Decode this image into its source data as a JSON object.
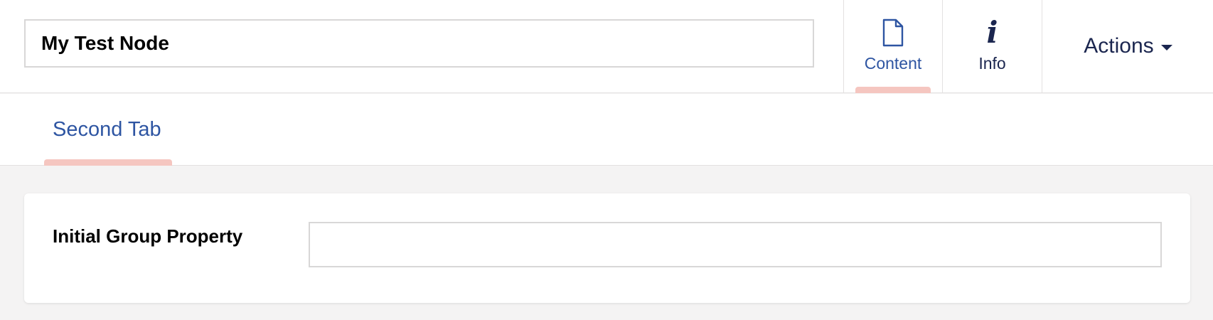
{
  "header": {
    "node_name": "My Test Node",
    "apps": [
      {
        "label": "Content",
        "icon": "document-icon",
        "active": true
      },
      {
        "label": "Info",
        "icon": "info-icon",
        "active": false
      }
    ],
    "actions_label": "Actions"
  },
  "tabs": [
    {
      "label": "Second Tab",
      "active": true
    }
  ],
  "group": {
    "property_label": "Initial Group Property",
    "property_value": ""
  },
  "colors": {
    "accent_blue": "#2e55a2",
    "dark_navy": "#1b264f",
    "active_indicator": "#f5c6c0",
    "page_background": "#f4f3f3"
  }
}
